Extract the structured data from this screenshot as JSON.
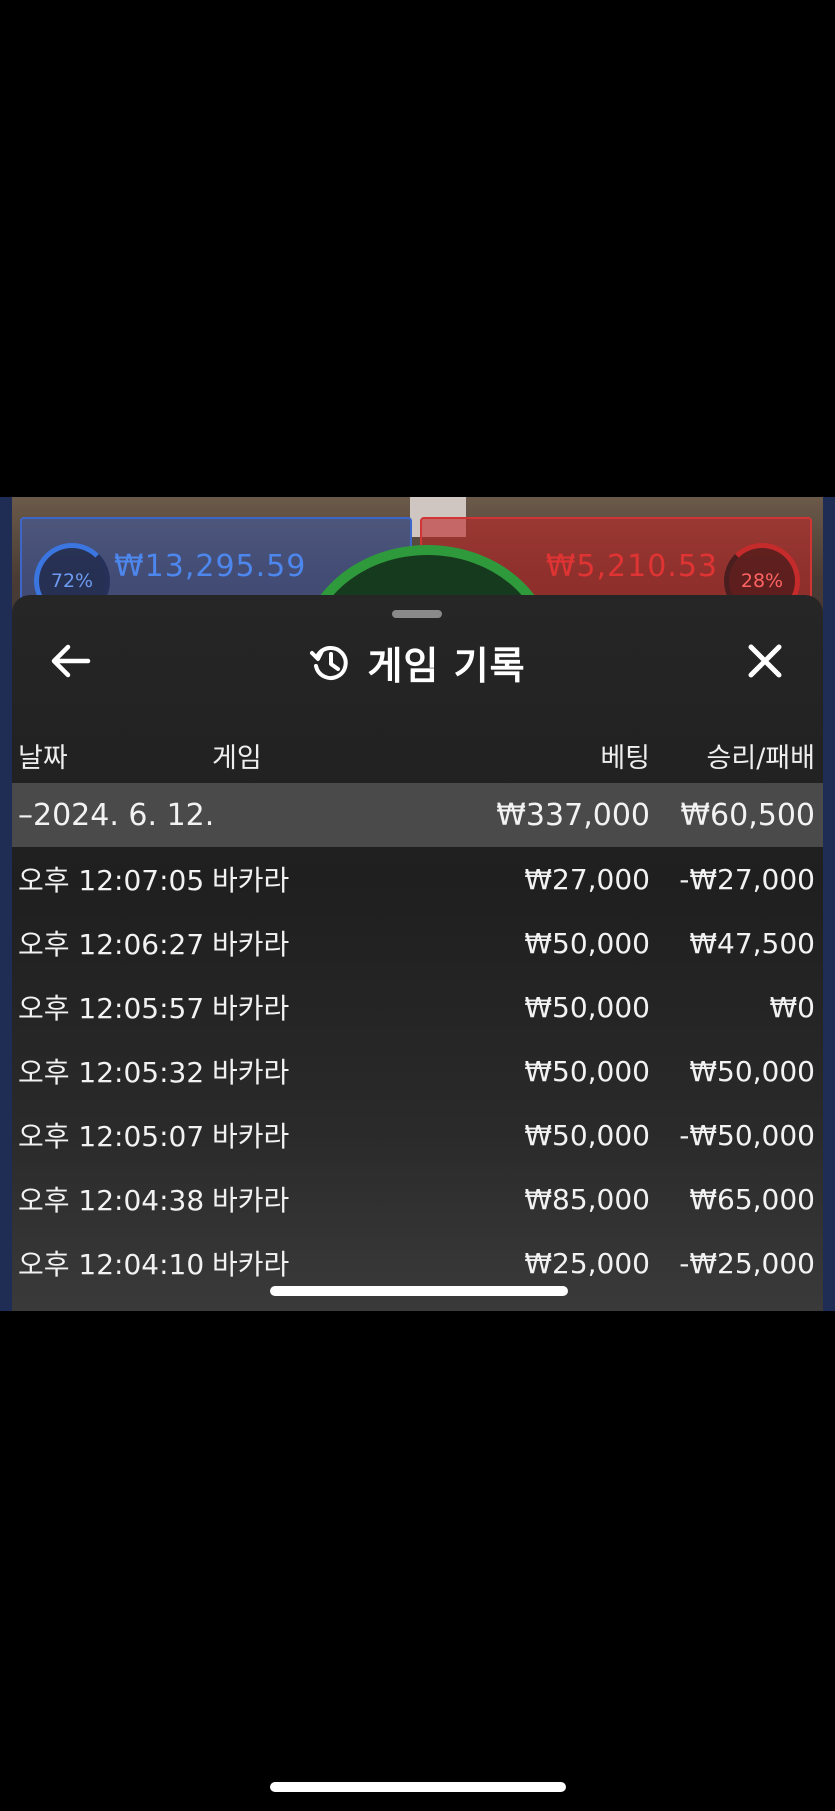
{
  "background_game": {
    "player": {
      "percent": "72%",
      "amount": "₩13,295.59"
    },
    "banker": {
      "amount": "₩5,210.53",
      "percent": "28%"
    }
  },
  "sheet": {
    "title": "게임 기록",
    "icons": {
      "back": "arrow-left-icon",
      "history": "history-icon",
      "close": "close-icon"
    }
  },
  "table": {
    "headers": {
      "date": "날짜",
      "game": "게임",
      "bet": "베팅",
      "result": "승리/패배"
    },
    "summary": {
      "date": "–2024. 6. 12.",
      "bet": "₩337,000",
      "result": "₩60,500"
    },
    "rows": [
      {
        "time": "오후 12:07:05",
        "game": "바카라",
        "bet": "₩27,000",
        "result": "-₩27,000"
      },
      {
        "time": "오후 12:06:27",
        "game": "바카라",
        "bet": "₩50,000",
        "result": "₩47,500"
      },
      {
        "time": "오후 12:05:57",
        "game": "바카라",
        "bet": "₩50,000",
        "result": "₩0"
      },
      {
        "time": "오후 12:05:32",
        "game": "바카라",
        "bet": "₩50,000",
        "result": "₩50,000"
      },
      {
        "time": "오후 12:05:07",
        "game": "바카라",
        "bet": "₩50,000",
        "result": "-₩50,000"
      },
      {
        "time": "오후 12:04:38",
        "game": "바카라",
        "bet": "₩85,000",
        "result": "₩65,000"
      },
      {
        "time": "오후 12:04:10",
        "game": "바카라",
        "bet": "₩25,000",
        "result": "-₩25,000"
      }
    ]
  }
}
